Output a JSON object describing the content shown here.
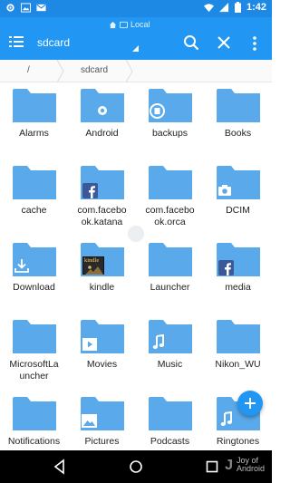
{
  "status_bar": {
    "time": "1:42",
    "left_icons": [
      "settings-icon",
      "image-icon",
      "gmail-icon"
    ],
    "right_icons": [
      "wifi-icon",
      "cell-signal-icon",
      "battery-icon"
    ]
  },
  "toolbar": {
    "tab_label": "Local",
    "title": "sdcard",
    "actions": [
      "search-icon",
      "close-icon",
      "more-vert-icon"
    ],
    "accent_color": "#2196f3",
    "status_color": "#1e88e5"
  },
  "breadcrumb": {
    "items": [
      "/",
      "sdcard"
    ]
  },
  "files": {
    "folder_color": "#5aa9ea",
    "items": [
      {
        "name": "Alarms",
        "badge": ""
      },
      {
        "name": "Android",
        "badge": "gear-icon"
      },
      {
        "name": "backups",
        "badge": "backup-icon"
      },
      {
        "name": "Books",
        "badge": ""
      },
      {
        "name": "cache",
        "badge": ""
      },
      {
        "name": "com.facebook.katana",
        "label1": "com.facebo",
        "label2": "ok.katana",
        "badge": "facebook-icon"
      },
      {
        "name": "com.facebook.orca",
        "label1": "com.facebo",
        "label2": "ok.orca",
        "badge": ""
      },
      {
        "name": "DCIM",
        "badge": "camera-icon"
      },
      {
        "name": "Download",
        "badge": "download-icon"
      },
      {
        "name": "kindle",
        "badge": "kindle-icon"
      },
      {
        "name": "Launcher",
        "badge": ""
      },
      {
        "name": "media",
        "badge": "facebook-icon"
      },
      {
        "name": "MicrosoftLauncher",
        "label1": "MicrosoftLa",
        "label2": "uncher",
        "badge": ""
      },
      {
        "name": "Movies",
        "badge": "play-icon"
      },
      {
        "name": "Music",
        "badge": "music-note-icon"
      },
      {
        "name": "Nikon_WU",
        "badge": ""
      },
      {
        "name": "Notifications",
        "badge": ""
      },
      {
        "name": "Pictures",
        "badge": "image-icon"
      },
      {
        "name": "Podcasts",
        "badge": ""
      },
      {
        "name": "Ringtones",
        "badge": "music-note-icon"
      }
    ]
  },
  "badges": {
    "kindle_text": "kindle"
  },
  "fab": {
    "icon": "plus-icon"
  },
  "nav_bar": {
    "buttons": [
      "back-icon",
      "home-icon",
      "recents-icon"
    ]
  },
  "watermark": {
    "line1": "Joy of",
    "line2": "Android",
    "logo": "J"
  }
}
